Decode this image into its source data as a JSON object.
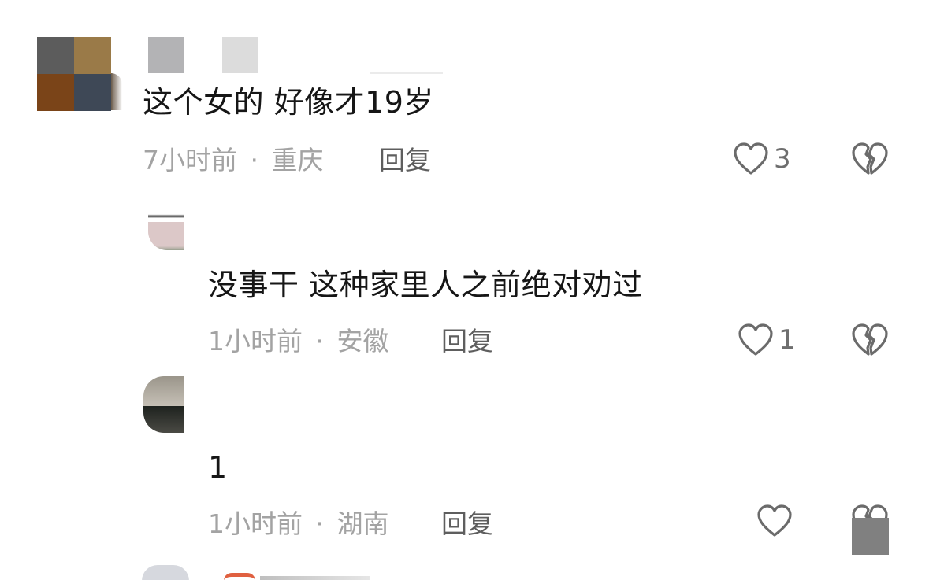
{
  "comments": [
    {
      "text": "这个女的 好像才19岁",
      "time": "7小时前",
      "separator": "·",
      "location": "重庆",
      "reply_label": "回复",
      "likes": "3",
      "like_icon": "heart-outline-icon",
      "dislike_icon": "broken-heart-icon"
    },
    {
      "text": "没事干 这种家里人之前绝对劝过",
      "time": "1小时前",
      "separator": "·",
      "location": "安徽",
      "reply_label": "回复",
      "likes": "1",
      "like_icon": "heart-outline-icon",
      "dislike_icon": "broken-heart-icon"
    },
    {
      "text": "1",
      "time": "1小时前",
      "separator": "·",
      "location": "湖南",
      "reply_label": "回复",
      "likes": "",
      "like_icon": "heart-outline-icon",
      "dislike_icon": "broken-heart-icon"
    }
  ],
  "colors": {
    "text": "#161616",
    "meta": "#a3a3a3",
    "reply": "#5e5e5e",
    "icon": "#6b6b6b"
  }
}
